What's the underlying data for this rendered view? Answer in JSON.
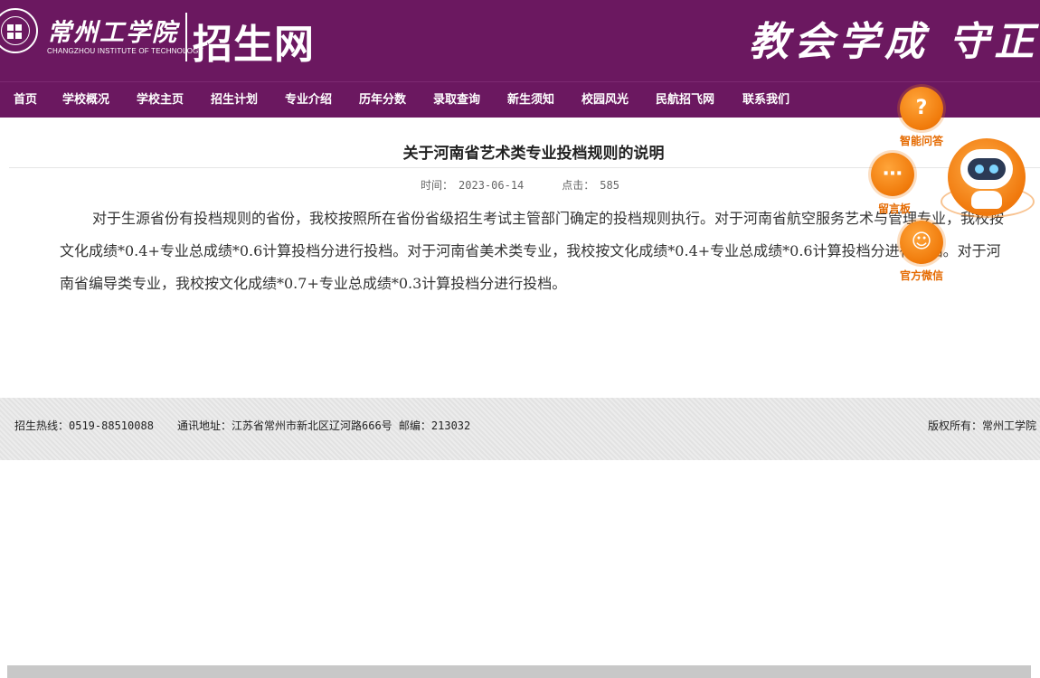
{
  "header": {
    "school_name_cn": "常州工学院",
    "school_name_en": "CHANGZHOU INSTITUTE OF TECHNOLOGY",
    "site_title": "招生网",
    "motto": "教会学成 守正有"
  },
  "nav": {
    "items": [
      {
        "label": "首页"
      },
      {
        "label": "学校概况"
      },
      {
        "label": "学校主页"
      },
      {
        "label": "招生计划"
      },
      {
        "label": "专业介绍"
      },
      {
        "label": "历年分数"
      },
      {
        "label": "录取查询"
      },
      {
        "label": "新生须知"
      },
      {
        "label": "校园风光"
      },
      {
        "label": "民航招飞网"
      },
      {
        "label": "联系我们"
      }
    ]
  },
  "article": {
    "title": "关于河南省艺术类专业投档规则的说明",
    "time_label": "时间：",
    "time_value": "2023-06-14",
    "clicks_label": "点击：",
    "clicks_value": "585",
    "body": "对于生源省份有投档规则的省份，我校按照所在省份省级招生考试主管部门确定的投档规则执行。对于河南省航空服务艺术与管理专业，我校按文化成绩*0.4+专业总成绩*0.6计算投档分进行投档。对于河南省美术类专业，我校按文化成绩*0.4+专业总成绩*0.6计算投档分进行投档。对于河南省编导类专业，我校按文化成绩*0.7+专业总成绩*0.3计算投档分进行投档。"
  },
  "floating": {
    "qa_label": "智能问答",
    "board_label": "留言板",
    "wechat_label": "官方微信",
    "qa_icon": "question-icon",
    "board_icon": "chat-bubble-icon",
    "wechat_icon": "wechat-icon"
  },
  "footer": {
    "hotline": "招生热线：0519-88510088",
    "address": "通讯地址：江苏省常州市新北区辽河路666号 邮编：213032",
    "copyright": "版权所有：常州工学院"
  },
  "colors": {
    "brand_purple": "#6b1860",
    "accent_orange": "#f07a0a"
  }
}
